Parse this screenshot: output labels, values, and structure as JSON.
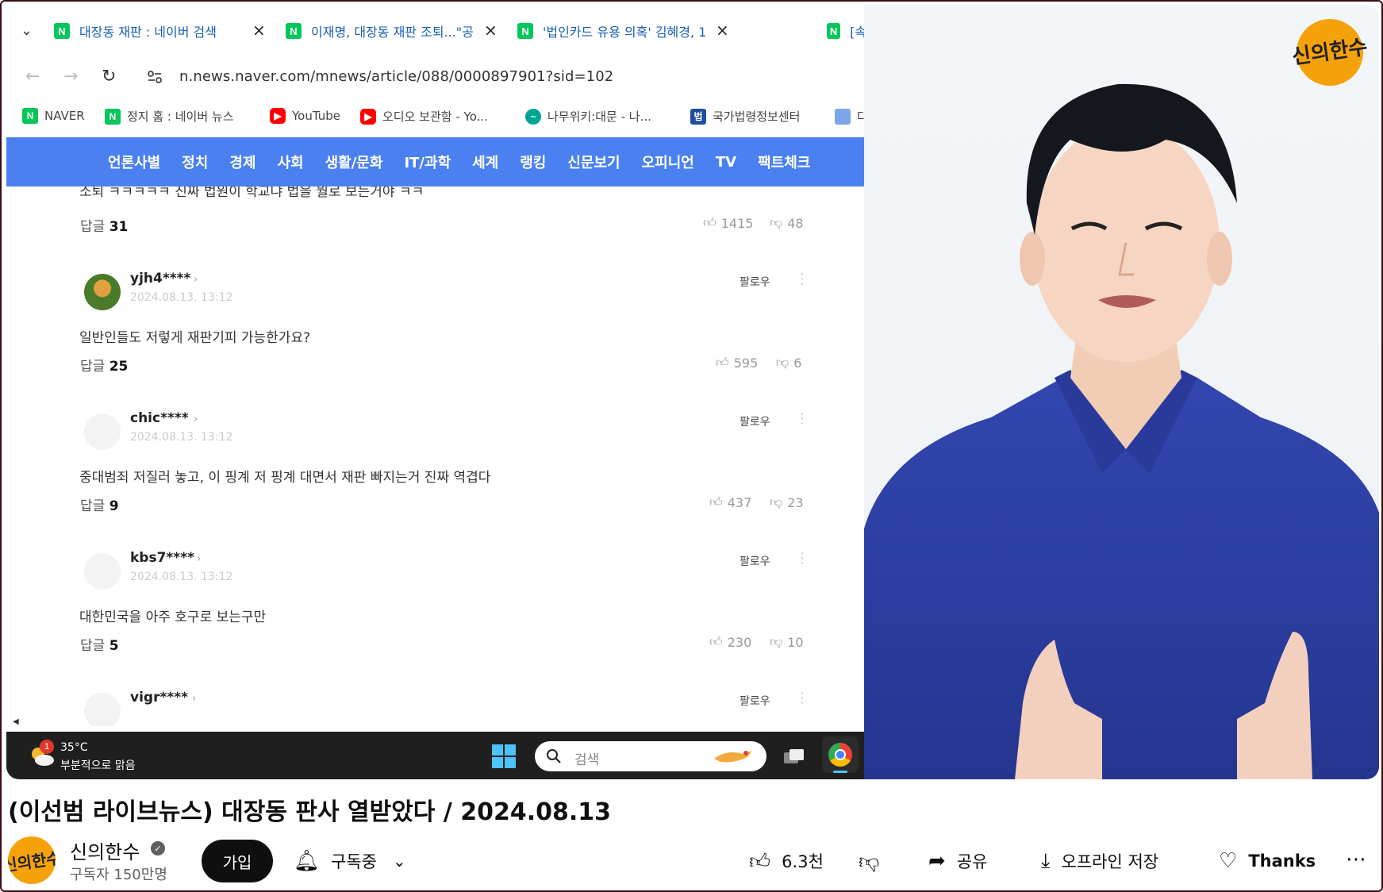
{
  "browser": {
    "tabs": [
      {
        "title": "대장동 재판 : 네이버 검색"
      },
      {
        "title": "이재명, 대장동 재판 조퇴...\"공"
      },
      {
        "title": "'법인카드 유용 의혹' 김혜경, 1"
      },
      {
        "title": "[속"
      }
    ],
    "tab_close_glyph": "×",
    "url": "n.news.naver.com/mnews/article/088/0000897901?sid=102",
    "bookmarks": [
      {
        "label": "NAVER",
        "icon": "naver-icon"
      },
      {
        "label": "정지 홈 : 네이버 뉴스",
        "icon": "naver-icon"
      },
      {
        "label": "YouTube",
        "icon": "youtube-icon"
      },
      {
        "label": "오디오 보관함 - Yo...",
        "icon": "youtube-icon"
      },
      {
        "label": "나무위키:대문 - 나...",
        "icon": "namuwiki-icon"
      },
      {
        "label": "국가법령정보센터",
        "icon": "law-icon"
      },
      {
        "label": "다",
        "icon": "generic-icon"
      }
    ]
  },
  "naver_nav": {
    "items": [
      "언론사별",
      "정치",
      "경제",
      "사회",
      "생활/문화",
      "IT/과학",
      "세계",
      "랭킹",
      "신문보기",
      "오피니언",
      "TV",
      "팩트체크"
    ]
  },
  "comments": {
    "cut_text": "소퇴 ㅋㅋㅋㅋㅋ 진짜 법원이 학교냐 법을 뭘로 보는거야 ㅋㅋ",
    "reply_label": "답글",
    "first": {
      "replies": "31",
      "likes": "1415",
      "dislikes": "48"
    },
    "follow_label": "팔로우",
    "items": [
      {
        "user": "yjh4****",
        "date": "2024.08.13. 13:12",
        "text": "일반인들도 저렇게 재판기피 가능한가요?",
        "replies": "25",
        "likes": "595",
        "dislikes": "6"
      },
      {
        "user": "chic****",
        "date": "2024.08.13. 13:12",
        "text": "중대범죄 저질러 놓고, 이 핑계 저 핑계 대면서 재판 빠지는거 진짜 역겹다",
        "replies": "9",
        "likes": "437",
        "dislikes": "23"
      },
      {
        "user": "kbs7****",
        "date": "2024.08.13. 13:12",
        "text": "대한민국을 아주 호구로 보는구만",
        "replies": "5",
        "likes": "230",
        "dislikes": "10"
      },
      {
        "user": "vigr****"
      }
    ]
  },
  "taskbar": {
    "weather_badge": "1",
    "temperature": "35°C",
    "weather_desc": "부분적으로 맑음",
    "search_placeholder": "검색"
  },
  "presenter": {
    "logo_text": "신의한수"
  },
  "video": {
    "title": "(이선범 라이브뉴스) 대장동 판사 열받았다 / 2024.08.13",
    "channel_name": "신의한수",
    "subscribers": "구독자 150만명",
    "join_label": "가입",
    "subscribe_label": "구독중",
    "like_count": "6.3천",
    "share_label": "공유",
    "download_label": "오프라인 저장",
    "thanks_label": "Thanks",
    "icons": {
      "bell": "bell-icon",
      "like": "thumbs-up-icon",
      "dislike": "thumbs-down-icon",
      "share": "share-icon",
      "download": "download-icon",
      "thanks": "thanks-icon",
      "more": "more-icon"
    }
  },
  "colors": {
    "naver_green": "#03c75a",
    "naver_nav_blue": "#4a80f0",
    "youtube_red": "#ff0000",
    "logo_orange": "#f5a20a",
    "shirt_blue": "#2c3fa8"
  }
}
